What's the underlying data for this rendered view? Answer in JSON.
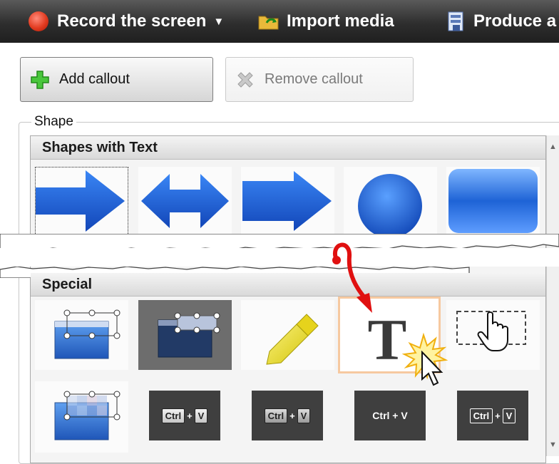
{
  "toolbar": {
    "record_label": "Record the screen",
    "import_label": "Import media",
    "produce_label": "Produce a"
  },
  "callout_buttons": {
    "add_label": "Add callout",
    "remove_label": "Remove callout"
  },
  "shape_group": {
    "label": "Shape",
    "sections": [
      {
        "title": "Shapes with Text"
      },
      {
        "title": "Special"
      }
    ]
  },
  "special_keys": {
    "ctrl": "Ctrl",
    "plus": "+",
    "v": "V",
    "ctrl_plus_v": "Ctrl + V"
  },
  "colors": {
    "toolbar_bg": "#2e2e2e",
    "shape_blue": "#1e63d6",
    "annotation_arrow": "#e01010",
    "selection_highlight": "#f6c9a0"
  }
}
